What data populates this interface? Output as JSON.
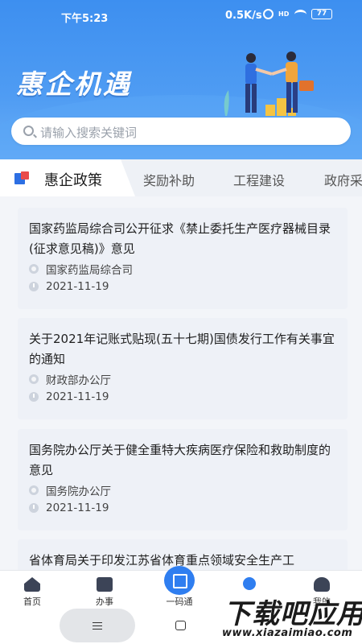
{
  "status_bar": {
    "time": "下午5:23",
    "network_speed": "0.5K/s",
    "battery": "77",
    "icons": [
      "alarm-icon",
      "hd-icon",
      "wifi-icon",
      "battery-icon"
    ]
  },
  "header": {
    "app_title": "惠企机遇",
    "illustration": "handshake-illustration"
  },
  "search": {
    "placeholder": "请输入搜索关键词"
  },
  "tabs": [
    {
      "label": "惠企政策",
      "active": true
    },
    {
      "label": "奖励补助",
      "active": false
    },
    {
      "label": "工程建设",
      "active": false
    },
    {
      "label": "政府采",
      "active": false
    }
  ],
  "articles": [
    {
      "title": "国家药监局综合司公开征求《禁止委托生产医疗器械目录(征求意见稿)》意见",
      "source": "国家药监局综合司",
      "date": "2021-11-19"
    },
    {
      "title": "关于2021年记账式贴现(五十七期)国债发行工作有关事宜的通知",
      "source": "财政部办公厅",
      "date": "2021-11-19"
    },
    {
      "title": "国务院办公厅关于健全重特大疾病医疗保险和救助制度的意见",
      "source": "国务院办公厅",
      "date": "2021-11-19"
    },
    {
      "title": "省体育局关于印发江苏省体育重点领域安全生产工",
      "source": "",
      "date": ""
    }
  ],
  "bottom_nav": [
    {
      "label": "首页",
      "icon": "home-icon"
    },
    {
      "label": "办事",
      "icon": "briefcase-icon"
    },
    {
      "label": "一码通",
      "icon": "qr-scan-icon"
    },
    {
      "label": "",
      "icon": "bulb-icon"
    },
    {
      "label": "我的",
      "icon": "user-icon"
    }
  ],
  "watermark": {
    "big": "下载吧应用",
    "small": "www.xiazaimiao.com"
  },
  "colors": {
    "header_blue": "#3d8ff0",
    "scan_button": "#2f7ef0",
    "card_bg": "#eef1f7"
  }
}
